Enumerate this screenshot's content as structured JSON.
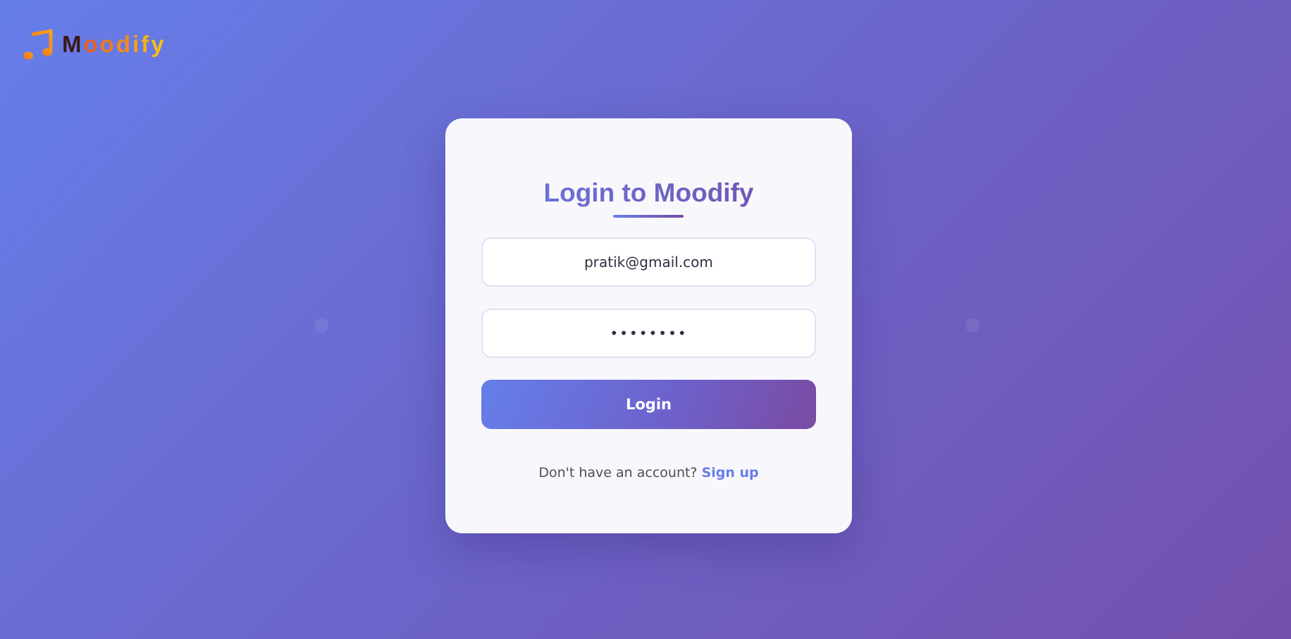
{
  "brand": {
    "name_letters": [
      "M",
      "o",
      "o",
      "d",
      "i",
      "f",
      "y"
    ],
    "letter_colors": [
      "#3b1a14",
      "#e8621f",
      "#ee7a1d",
      "#f28d1b",
      "#f5a019",
      "#f7b218",
      "#f9c016"
    ],
    "icon": "music-note-icon",
    "icon_color": "#f47a1f"
  },
  "login": {
    "title": "Login to Moodify",
    "email_value": "pratik@gmail.com",
    "password_value": "password",
    "button_label": "Login",
    "signup_prompt": "Don't have an account?",
    "signup_link": "Sign up"
  },
  "colors": {
    "gradient_start": "#667eea",
    "gradient_end": "#764ba2",
    "card_background": "#f8f8fc"
  }
}
